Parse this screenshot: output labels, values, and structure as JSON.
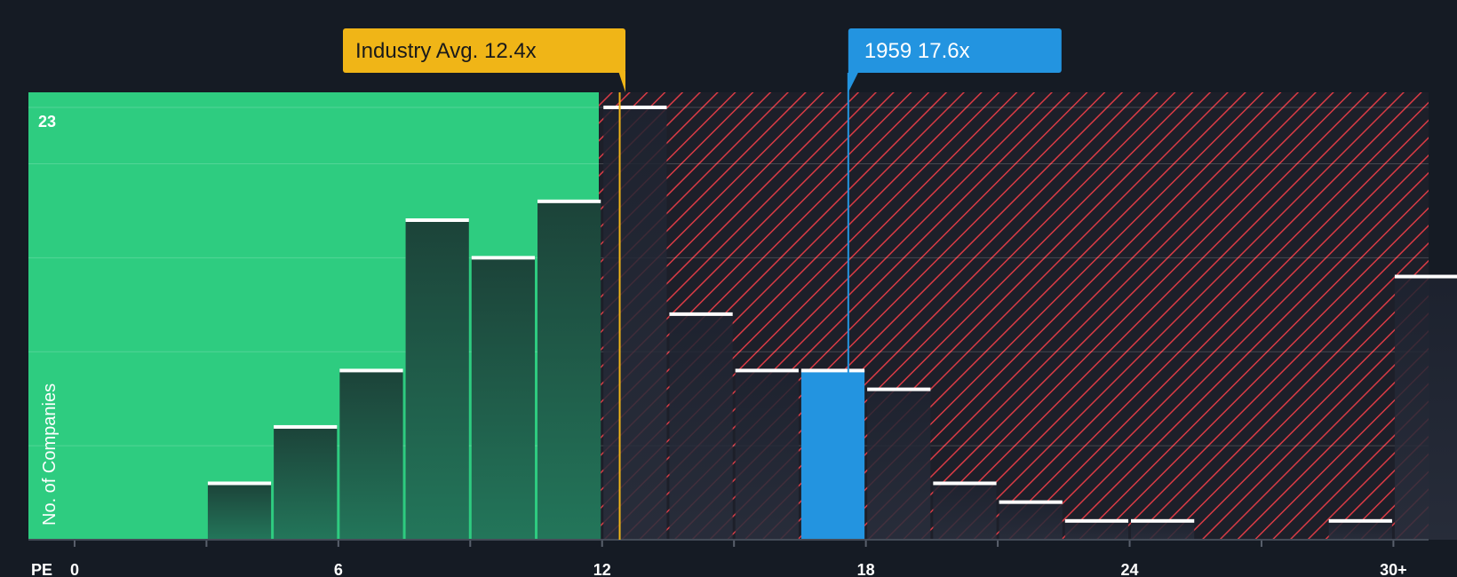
{
  "chart_data": {
    "type": "bar",
    "x_axis_label": "PE",
    "y_axis_label": "No. of Companies",
    "y_max_label": "23",
    "x_ticks": [
      "0",
      "6",
      "12",
      "18",
      "24",
      "30+"
    ],
    "x_tick_values": [
      0,
      6,
      12,
      18,
      24,
      30
    ],
    "xlim": [
      -1.05,
      30.8
    ],
    "ylim": [
      0,
      23.8
    ],
    "bin_width": 1.5,
    "bins": [
      {
        "start": 3,
        "value": 3
      },
      {
        "start": 4.5,
        "value": 6
      },
      {
        "start": 6,
        "value": 9
      },
      {
        "start": 7.5,
        "value": 17
      },
      {
        "start": 9,
        "value": 15
      },
      {
        "start": 10.5,
        "value": 18
      },
      {
        "start": 12,
        "value": 23
      },
      {
        "start": 13.5,
        "value": 12
      },
      {
        "start": 15,
        "value": 9
      },
      {
        "start": 16.5,
        "value": 9,
        "highlight": true
      },
      {
        "start": 18,
        "value": 8
      },
      {
        "start": 19.5,
        "value": 3
      },
      {
        "start": 21,
        "value": 2
      },
      {
        "start": 22.5,
        "value": 1
      },
      {
        "start": 24,
        "value": 1
      },
      {
        "start": 28.5,
        "value": 1
      },
      {
        "start": 30,
        "value": 14
      }
    ],
    "fair_region_end": 12,
    "industry_avg": {
      "label": "Industry Avg. 12.4x",
      "value": 12.4
    },
    "company": {
      "label": "1959 17.6x",
      "value": 17.6
    },
    "colors": {
      "background": "#151b24",
      "fair_region": "#2ecc80",
      "over_region_hatch": "#d93b45",
      "bar_fair": "#1f4a40",
      "bar_over": "#232935",
      "bar_highlight": "#2394e0",
      "bar_cap": "#ffffff",
      "industry_callout": "#f0b517",
      "company_callout": "#2394e0"
    }
  }
}
